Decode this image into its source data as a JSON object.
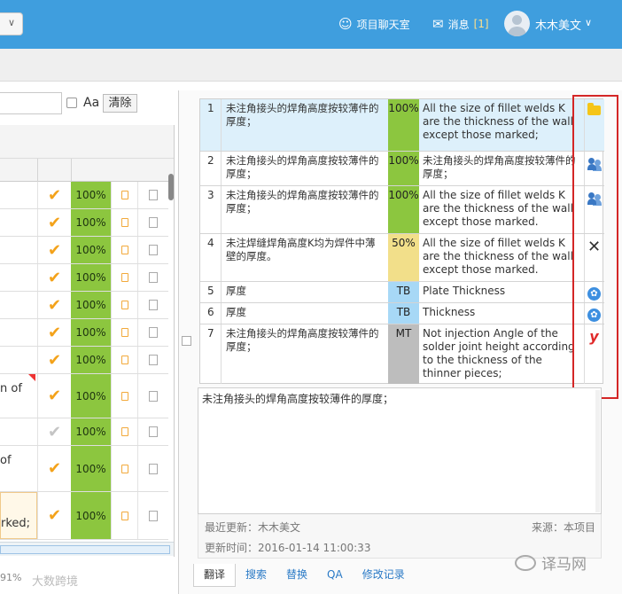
{
  "header": {
    "chat_label": "项目聊天室",
    "messages_label": "消息",
    "messages_count": "[1]",
    "user_name": "木木美文"
  },
  "search": {
    "case_label": "Aa",
    "clear_label": "清除"
  },
  "left_grid": {
    "rows": [
      {
        "text": "",
        "check": "✔",
        "pct": "100%"
      },
      {
        "text": "",
        "check": "✔",
        "pct": "100%"
      },
      {
        "text": "",
        "check": "✔",
        "pct": "100%"
      },
      {
        "text": "",
        "check": "✔",
        "pct": "100%"
      },
      {
        "text": "",
        "check": "✔",
        "pct": "100%"
      },
      {
        "text": "",
        "check": "✔",
        "pct": "100%"
      },
      {
        "text": "",
        "check": "✔",
        "pct": "100%"
      },
      {
        "text": "n of",
        "check": "✔",
        "pct": "100%"
      },
      {
        "text": "",
        "check": "✔",
        "pct": "100%"
      },
      {
        "text": "of",
        "check": "✔",
        "pct": "100%"
      },
      {
        "text": "rked;",
        "check": "✔",
        "pct": "100%"
      }
    ],
    "status": "91%",
    "watermark": "大数跨境"
  },
  "tm_matches": [
    {
      "num": "1",
      "source": "未注角接头的焊角高度按较薄件的厚度；",
      "match": "100%",
      "target": "All the size of fillet welds K are the thickness of the wall except those marked;",
      "origin_icon": "folder-icon"
    },
    {
      "num": "2",
      "source": "未注角接头的焊角高度按较薄件的厚度；",
      "match": "100%",
      "target": "未注角接头的焊角高度按较薄件的厚度；",
      "origin_icon": "users-icon"
    },
    {
      "num": "3",
      "source": "未注角接头的焊角高度按较薄件的厚度；",
      "match": "100%",
      "target": "All the size of fillet welds K are the thickness of the wall except those marked.",
      "origin_icon": "users-icon"
    },
    {
      "num": "4",
      "source": "未注焊缝焊角高度K均为焊件中薄壁的厚度。",
      "match": "50%",
      "target": "All the size of fillet welds K are the thickness of the wall except those marked.",
      "origin_icon": "x-icon"
    },
    {
      "num": "5",
      "source": "厚度",
      "match": "TB",
      "target": "Plate Thickness",
      "origin_icon": "paw-icon"
    },
    {
      "num": "6",
      "source": "厚度",
      "match": "TB",
      "target": "Thickness",
      "origin_icon": "paw-icon"
    },
    {
      "num": "7",
      "source": "未注角接头的焊角高度按较薄件的厚度；",
      "match": "MT",
      "target": "Not injection Angle of the solder joint height according to the thickness of the thinner pieces;",
      "origin_icon": "y-icon"
    }
  ],
  "colors": {
    "header_bg": "#3f9ede",
    "match_100": "#8cc63f",
    "match_50": "#f2df8a",
    "match_tb": "#a7d8f6",
    "match_mt": "#bdbdbd",
    "highlight": "#d42626"
  },
  "editor": {
    "text": "未注角接头的焊角高度按较薄件的厚度；"
  },
  "info": {
    "updater": "最近更新：木木美文",
    "source": "来源：本项目",
    "time": "更新时间：2016-01-14 11:00:33"
  },
  "tabs": [
    "翻译",
    "搜索",
    "替换",
    "QA",
    "修改记录"
  ],
  "watermark": "译马网"
}
